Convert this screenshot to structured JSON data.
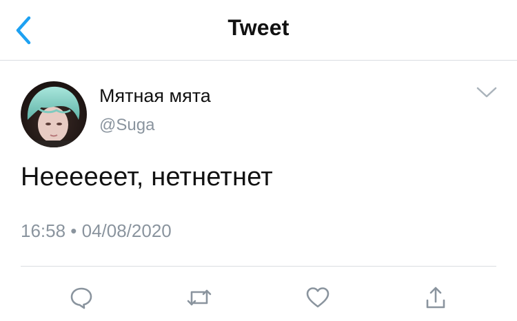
{
  "header": {
    "title": "Tweet",
    "back_icon": "chevron-left-icon"
  },
  "colors": {
    "accent": "#1da1f2",
    "text": "#111111",
    "secondary_text": "#8a949e",
    "divider": "#d9dde1",
    "icon": "#8a949e"
  },
  "tweet": {
    "author_name": "Мятная мята",
    "author_handle": "@Suga",
    "text": "Неееееет, нетнетнет",
    "timestamp": "16:58 • 04/08/2020"
  },
  "actions": [
    {
      "name": "reply",
      "icon": "comment-bubble-icon"
    },
    {
      "name": "retweet",
      "icon": "retweet-icon"
    },
    {
      "name": "like",
      "icon": "heart-icon"
    },
    {
      "name": "share",
      "icon": "share-upload-icon"
    }
  ]
}
